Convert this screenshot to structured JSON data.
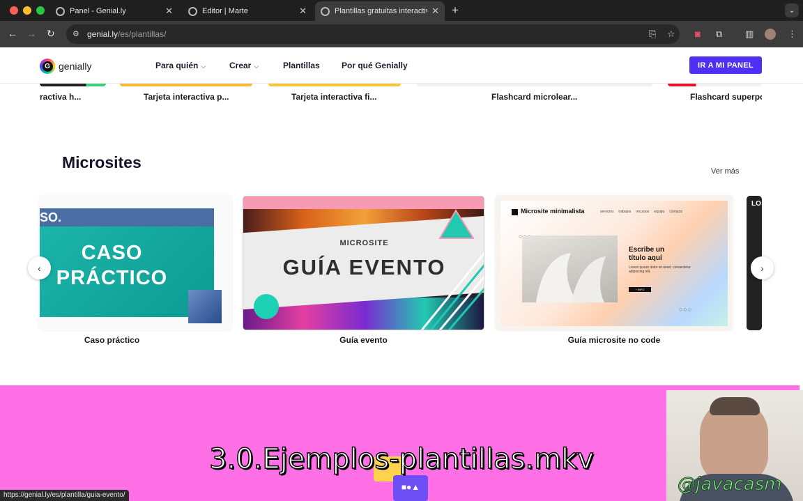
{
  "browser": {
    "tabs": [
      {
        "title": "Panel - Genial.ly",
        "active": false
      },
      {
        "title": "Editor | Marte",
        "active": false
      },
      {
        "title": "Plantillas gratuitas interactiva",
        "active": true
      }
    ],
    "new_tab": "+",
    "close": "✕",
    "tab_menu": "⌄",
    "url_host": "genial.ly",
    "url_path": "/es/plantillas/",
    "status_url": "https://genial.ly/es/plantilla/guia-evento/"
  },
  "site": {
    "logo_text": "genially",
    "logo_letter": "G",
    "nav": [
      {
        "label": "Para quién",
        "dropdown": true
      },
      {
        "label": "Crear",
        "dropdown": true
      },
      {
        "label": "Plantillas",
        "dropdown": false
      },
      {
        "label": "Por qué Genially",
        "dropdown": false
      }
    ],
    "cta": "IR A MI PANEL"
  },
  "previous_row": {
    "labels": [
      "ractiva h...",
      "Tarjeta interactiva p...",
      "Tarjeta interactiva fi...",
      "Flashcard microlear...",
      "Flashcard superpo"
    ]
  },
  "microsites": {
    "title": "Microsites",
    "see_more": "Ver más",
    "cards": [
      {
        "label": "Caso práctico",
        "thumb_text_1": "CASO",
        "thumb_text_2": "PRÁCTICO",
        "thumb_corner": "SO."
      },
      {
        "label": "Guía evento",
        "thumb_kicker": "MICROSITE",
        "thumb_title": "GUÍA EVENTO"
      },
      {
        "label": "Guía microsite no code",
        "thumb_brand": "Microsite minimalista",
        "thumb_menu": [
          "servicios",
          "trabajos",
          "recursos",
          "equipo",
          "contacto"
        ],
        "thumb_heading_1": "Escribe un",
        "thumb_heading_2": "título aquí",
        "thumb_body": "Lorem ipsum dolor sit amet, consectetur adipiscing elit.",
        "thumb_button": "+ INFO"
      },
      {
        "label": "",
        "thumb_corner": "LO"
      }
    ],
    "prev_arrow": "‹",
    "next_arrow": "›"
  },
  "video": {
    "caption": "3.0.Ejemplos-plantillas.mkv",
    "handle": "@javacasm"
  },
  "colors": {
    "cta": "#4f2ff5",
    "banner": "#ff6fe6",
    "teal": "#17b3a6"
  }
}
